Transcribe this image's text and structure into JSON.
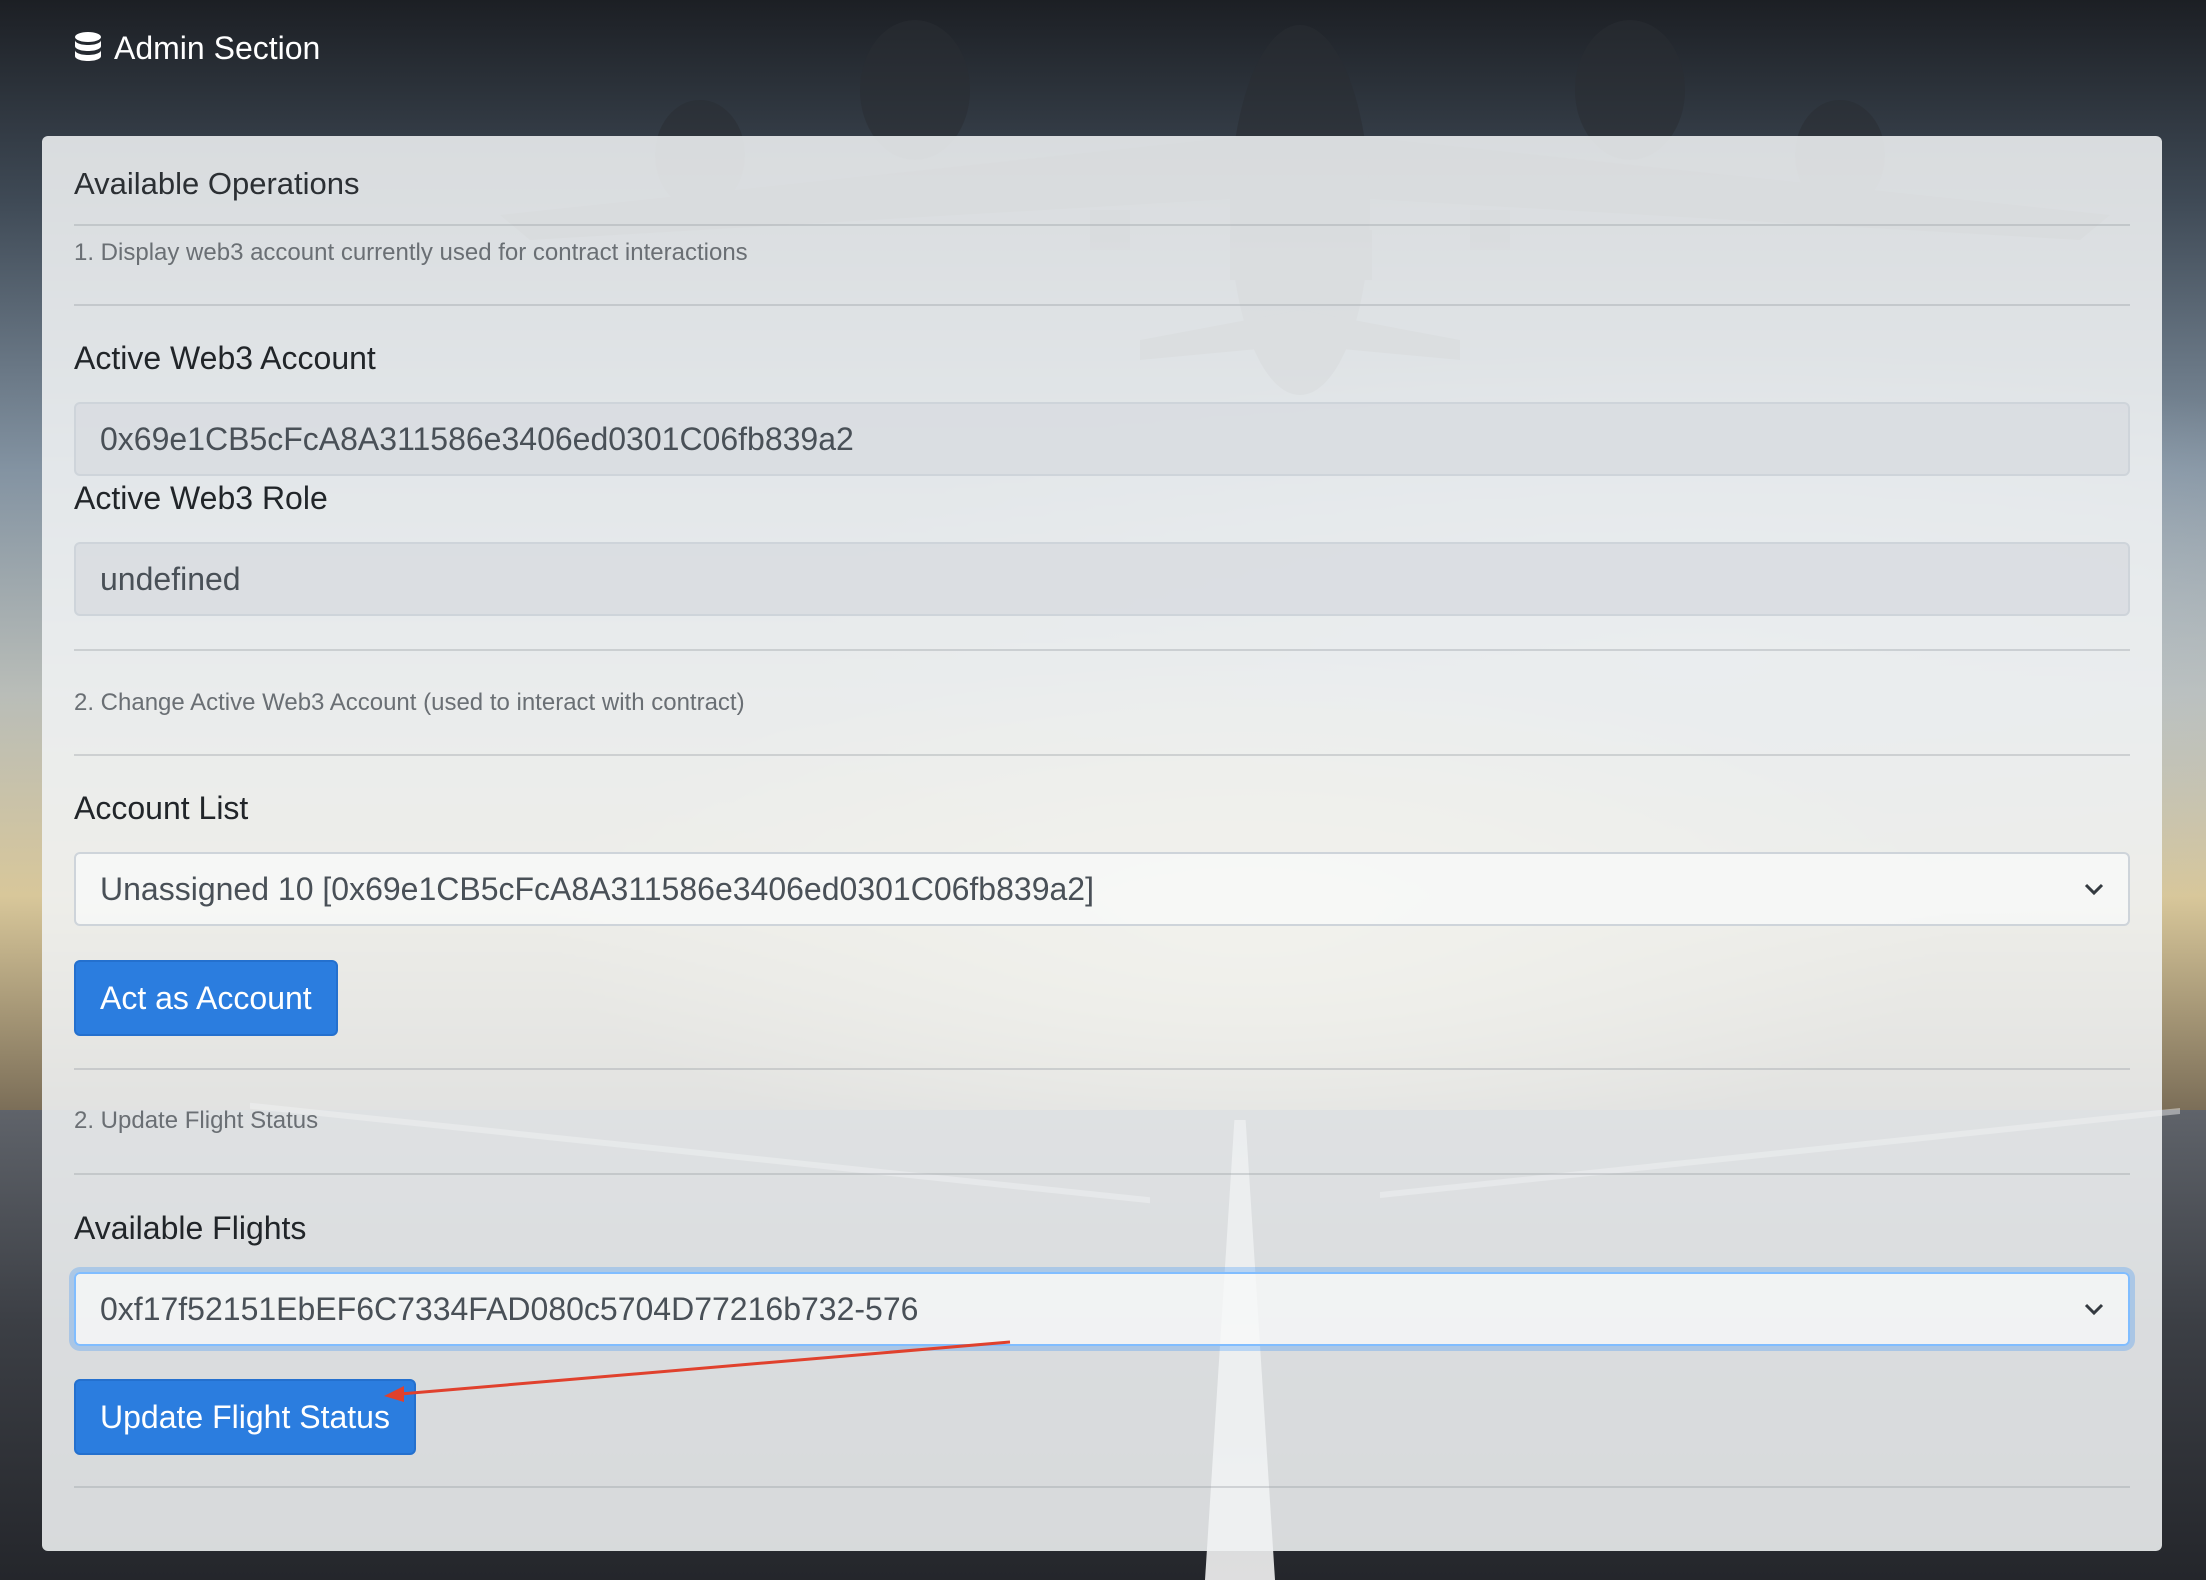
{
  "header": {
    "icon": "database-icon",
    "title": "Admin Section"
  },
  "panel": {
    "title": "Available Operations",
    "step1": "1. Display web3 account currently used for contract interactions",
    "active_account": {
      "label": "Active Web3 Account",
      "value": "0x69e1CB5cFcA8A311586e3406ed0301C06fb839a2"
    },
    "active_role": {
      "label": "Active Web3 Role",
      "value": "undefined"
    },
    "step2": "2. Change Active Web3 Account (used to interact with contract)",
    "account_list": {
      "label": "Account List",
      "selected": "Unassigned 10 [0x69e1CB5cFcA8A311586e3406ed0301C06fb839a2]"
    },
    "act_button": "Act as Account",
    "step3": "2. Update Flight Status",
    "flights": {
      "label": "Available Flights",
      "selected": "0xf17f52151EbEF6C7334FAD080c5704D77216b732-576"
    },
    "update_button": "Update Flight Status"
  },
  "colors": {
    "primary_button": "#2b7ddf",
    "annotation_arrow": "#e0412d",
    "focus_ring": "#80bdff"
  }
}
